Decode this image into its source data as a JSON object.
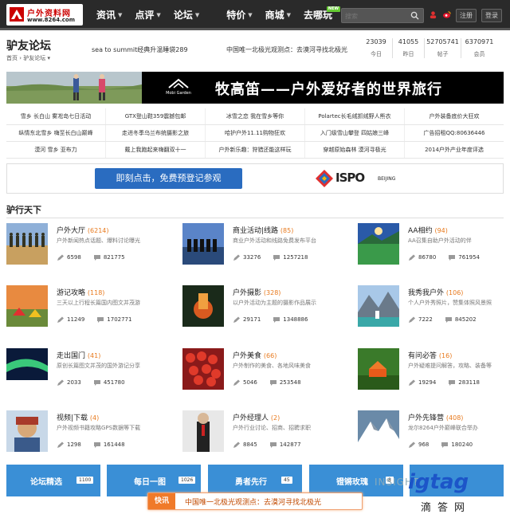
{
  "site": {
    "logo_text": "户外资料网",
    "logo_url": "www.8264.com"
  },
  "nav": {
    "items": [
      {
        "label": "资讯",
        "has_caret": true
      },
      {
        "label": "点评",
        "has_caret": true
      },
      {
        "label": "论坛",
        "has_caret": true
      },
      {
        "label": "特价",
        "has_caret": true
      },
      {
        "label": "商城",
        "has_caret": true
      },
      {
        "label": "去哪玩",
        "has_caret": false
      }
    ],
    "new_badge": "NEW",
    "search_placeholder": "搜索",
    "register_label": "注册",
    "login_label": "登录"
  },
  "forum": {
    "title": "驴友论坛",
    "breadcrumb": "首页 › 驴友论坛 ▾",
    "marquee": [
      "sea to summit经典升温睡袋289",
      "中国唯一北极光观测点：去漠河寻找北极光"
    ],
    "stats": [
      {
        "value": "23039",
        "label": "今日"
      },
      {
        "value": "41055",
        "label": "昨日"
      },
      {
        "value": "52705741",
        "label": "帖子"
      },
      {
        "value": "6370971",
        "label": "会员"
      }
    ]
  },
  "banner": {
    "brand": "Mobi Garden",
    "headline": "牧高笛——户外爱好者的世界旅行"
  },
  "links": [
    [
      "雪乡 长白山 雾凇岛七日活动",
      "GTX登山鞋359震撼包邮",
      "冰雪之恋 我在雪乡等你",
      "Polartec长毛绒抓绒野人熊衣",
      "户外装备底价大狂欢"
    ],
    [
      "纵情东北雪乡 嗨至长白山巅峰",
      "走进冬季乌兰布统摄影之旅",
      "哈护户外11.11购物狂欢",
      "入门级雪山攀登 四姑娘三峰",
      "广告招租QQ:80636446"
    ],
    [
      "漠河 雪乡 亚布力",
      "戴上我跑起来嗨翻双十一",
      "户外新乐趣：狩猎还能这样玩",
      "穿越原始森林 漠河寻极光",
      "2014户外产业年度评选"
    ]
  ],
  "ispo": {
    "button": "即刻点击，免费预登记参观",
    "logo": "ISPO",
    "city": "BEIJING"
  },
  "section_title": "驴行天下",
  "forums": [
    {
      "name": "户外大厅",
      "count": "(6214)",
      "desc": "户外新闻热点话题、爆料讨论曝光",
      "threads": "6598",
      "posts": "821775"
    },
    {
      "name": "商业活动|线路",
      "count": "(85)",
      "desc": "商业户外活动和线路免费发布平台",
      "threads": "33276",
      "posts": "1257218"
    },
    {
      "name": "AA相约",
      "count": "(94)",
      "desc": "AA召集自助户外活动的伴",
      "threads": "86780",
      "posts": "761954"
    },
    {
      "name": "游记攻略",
      "count": "(118)",
      "desc": "三天以上行程长篇国内图文并茂游",
      "threads": "11249",
      "posts": "1702771"
    },
    {
      "name": "户外摄影",
      "count": "(328)",
      "desc": "以户外活动为主题的摄影作品展示",
      "threads": "29171",
      "posts": "1348886"
    },
    {
      "name": "我秀我户外",
      "count": "(106)",
      "desc": "个人户外秀照片，赞集体照风景照",
      "threads": "7222",
      "posts": "845202"
    },
    {
      "name": "走出国门",
      "count": "(41)",
      "desc": "原创长篇图文并茂的国外游记分享",
      "threads": "2033",
      "posts": "451780"
    },
    {
      "name": "户外美食",
      "count": "(66)",
      "desc": "户外制作的美食、各地风味美食",
      "threads": "5046",
      "posts": "253548"
    },
    {
      "name": "有问必答",
      "count": "(16)",
      "desc": "户外疑难提问解答，攻略、装备等",
      "threads": "19294",
      "posts": "283118"
    },
    {
      "name": "视频|下载",
      "count": "(4)",
      "desc": "户外视频书籍攻略GPS数据等下载",
      "threads": "1298",
      "posts": "161448"
    },
    {
      "name": "户外经理人",
      "count": "(2)",
      "desc": "户外行业讨论、招商、招聘求职",
      "threads": "8845",
      "posts": "142877"
    },
    {
      "name": "户外先锋营",
      "count": "(408)",
      "desc": "龙尔8264户外巅峰联合举办",
      "threads": "968",
      "posts": "180240"
    }
  ],
  "bottom_tabs": [
    {
      "label": "论坛精选",
      "count": "1100"
    },
    {
      "label": "每日一图",
      "count": "1026"
    },
    {
      "label": "勇者先行",
      "count": "45"
    },
    {
      "label": "镫锵玫瑰",
      "count": "8"
    },
    {
      "label": "",
      "count": ""
    }
  ],
  "flash": {
    "tag": "快讯",
    "text": "中国唯一北极光观测点：去漠河寻找北极光"
  },
  "watermark": {
    "insight": "INSIGHT",
    "brand": "igtag",
    "cn": "滴答网"
  },
  "colors": {
    "topbar": "#2a2a2a",
    "accent_blue": "#3a8fd6",
    "count_orange": "#e87a1e",
    "flash_orange": "#f07a2a"
  }
}
